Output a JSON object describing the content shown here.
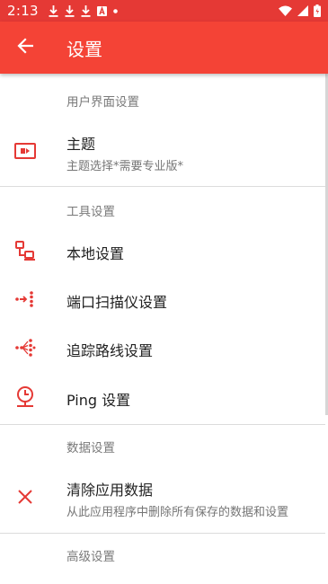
{
  "status_bar": {
    "time": "2:13",
    "icons": [
      "download-icon",
      "download-icon",
      "download-icon",
      "text-icon",
      "dot-icon",
      "wifi-icon",
      "signal-icon",
      "battery-icon"
    ]
  },
  "app_bar": {
    "title": "设置",
    "back_icon": "arrow-back-icon",
    "color": "#f44336"
  },
  "status_bar_color": "#e53935",
  "accent_color": "#e53935",
  "sections": {
    "ui": {
      "header": "用户界面设置",
      "items": [
        {
          "title": "主题",
          "summary": "主题选择*需要专业版*",
          "icon": "theme-icon"
        }
      ]
    },
    "tools": {
      "header": "工具设置",
      "items": [
        {
          "title": "本地设置",
          "icon": "local-network-icon"
        },
        {
          "title": "端口扫描仪设置",
          "icon": "port-scanner-icon"
        },
        {
          "title": "追踪路线设置",
          "icon": "traceroute-icon"
        },
        {
          "title": "Ping 设置",
          "icon": "ping-icon"
        }
      ]
    },
    "data": {
      "header": "数据设置",
      "items": [
        {
          "title": "清除应用数据",
          "summary": "从此应用程序中删除所有保存的数据和设置",
          "icon": "clear-icon"
        }
      ]
    },
    "advanced": {
      "header": "高级设置"
    }
  }
}
